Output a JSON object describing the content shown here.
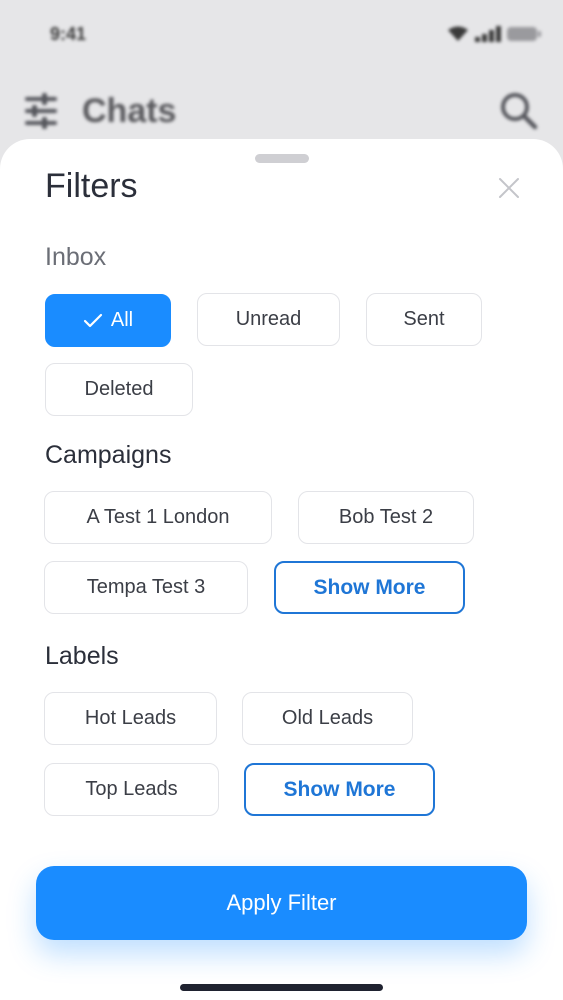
{
  "status_bar": {
    "time": "9:41"
  },
  "background": {
    "title": "Chats"
  },
  "sheet": {
    "title": "Filters",
    "sections": {
      "inbox": {
        "label": "Inbox",
        "options": [
          "All",
          "Unread",
          "Sent",
          "Deleted"
        ],
        "selected": "All"
      },
      "campaigns": {
        "label": "Campaigns",
        "options": [
          "A Test 1 London",
          "Bob Test 2",
          "Tempa Test 3"
        ],
        "show_more": "Show More"
      },
      "labels": {
        "label": "Labels",
        "options": [
          "Hot Leads",
          "Old Leads",
          "Top Leads"
        ],
        "show_more": "Show More"
      }
    },
    "apply_label": "Apply Filter"
  },
  "colors": {
    "accent": "#1a8cff",
    "outline_accent": "#1f76d6",
    "text": "#2b2f3a",
    "chip_border": "#e3e4e8"
  },
  "icons": {
    "filter": "sliders-icon",
    "search": "search-icon",
    "close": "close-icon",
    "check": "check-icon"
  }
}
